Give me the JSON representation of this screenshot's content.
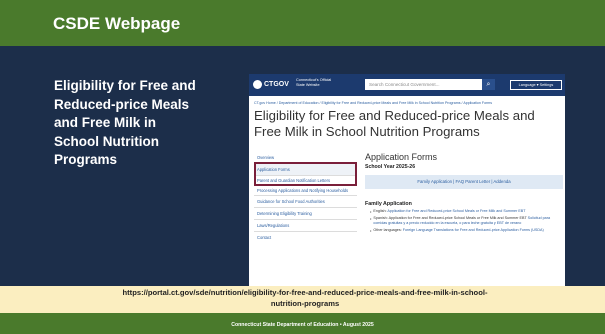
{
  "slide": {
    "title": "CSDE Webpage",
    "left_text": "Eligibility for Free and\nReduced-price Meals\nand Free Milk in\nSchool Nutrition\nPrograms",
    "url": "https://portal.ct.gov/sde/nutrition/eligibility-for-free-and-reduced-price-meals-and-free-milk-in-school-nutrition-programs",
    "footer": "Connecticut State Department of Education • August 2025"
  },
  "colors": {
    "green": "#4a7a2c",
    "navy": "#1c2e4a",
    "highlight_box": "#7a1f3a",
    "url_bg": "#fbeec0"
  },
  "screenshot": {
    "logo": "CTGOV",
    "official": "Connecticut's Official State Website",
    "search_placeholder": "Search Connecticut Government...",
    "search_icon": "search-icon",
    "language_btn": "Language ▾ Settings",
    "breadcrumb": "CT.gov Home  /  Department of Education  /  Eligibility for Free and Reduced-price Meals and Free Milk in School Nutrition Programs  /  Application Forms",
    "page_heading": "Eligibility for Free and Reduced-price Meals and Free Milk in School Nutrition Programs",
    "sidenav": [
      "Overview",
      "Application Forms",
      "Parent and Guardian Notification Letters",
      "Processing Applications and Notifying Households",
      "Guidance for School Food Authorities",
      "Determining Eligibility Training",
      "Laws/Regulations",
      "Contact"
    ],
    "section_title": "Application Forms",
    "school_year": "School Year 2025-26",
    "links_bar": "Family Application  |  FAQ Parent Letter  |  Addenda",
    "family_heading": "Family Application",
    "family_items": [
      {
        "prefix": "English: ",
        "link": "Application for Free and Reduced-price School Meals or Free Milk and Summer EBT"
      },
      {
        "prefix": "Spanish: Application for Free and Reduced-price School Meals or Free Milk and Summer EBT ",
        "link": "Solicitud para comidas gratuitas y a precio reducido en la escuela, o para leche gratuita y EBT de verano"
      },
      {
        "prefix": "Other languages: ",
        "link": "Foreign Language Translations for Free and Reduced-price Application Forms (USDA)"
      }
    ]
  }
}
